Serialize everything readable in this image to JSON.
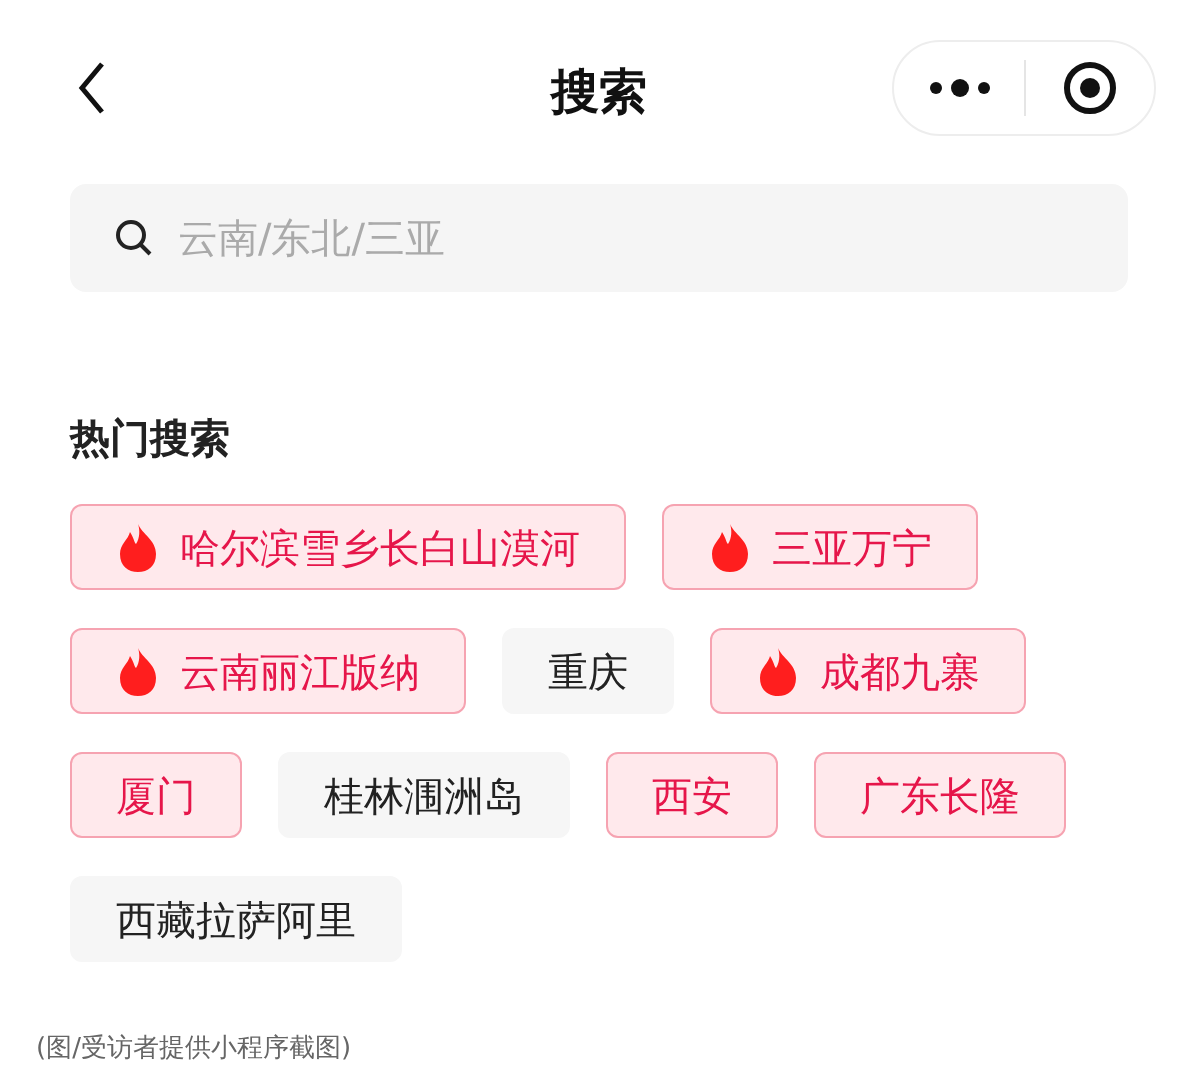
{
  "nav": {
    "title": "搜索"
  },
  "search": {
    "placeholder": "云南/东北/三亚"
  },
  "hot": {
    "heading": "热门搜索",
    "tags": [
      {
        "label": "哈尔滨雪乡长白山漠河",
        "kind": "hot"
      },
      {
        "label": "三亚万宁",
        "kind": "hot"
      },
      {
        "label": "云南丽江版纳",
        "kind": "hot"
      },
      {
        "label": "重庆",
        "kind": "plain"
      },
      {
        "label": "成都九寨",
        "kind": "hot"
      },
      {
        "label": "厦门",
        "kind": "pink"
      },
      {
        "label": "桂林涠洲岛",
        "kind": "plain"
      },
      {
        "label": "西安",
        "kind": "pink"
      },
      {
        "label": "广东长隆",
        "kind": "pink"
      },
      {
        "label": "西藏拉萨阿里",
        "kind": "plain"
      }
    ]
  },
  "caption": "(图/受访者提供小程序截图)"
}
